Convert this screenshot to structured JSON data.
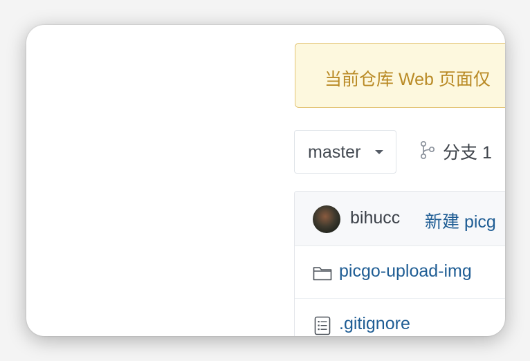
{
  "notice": {
    "text": "当前仓库 Web 页面仅"
  },
  "branch": {
    "selected": "master",
    "count_label": "分支 1"
  },
  "commit": {
    "author": "bihucc",
    "message": "新建 picg"
  },
  "files": [
    {
      "type": "folder",
      "name": "picgo-upload-img"
    },
    {
      "type": "file",
      "name": ".gitignore"
    }
  ],
  "colors": {
    "notice_bg": "#fdf8de",
    "notice_text": "#b98a25",
    "link": "#1f5d94"
  },
  "icons": {
    "branch": "branch-icon",
    "folder": "folder-icon",
    "file": "file-text-icon",
    "caret": "caret-down-icon"
  }
}
